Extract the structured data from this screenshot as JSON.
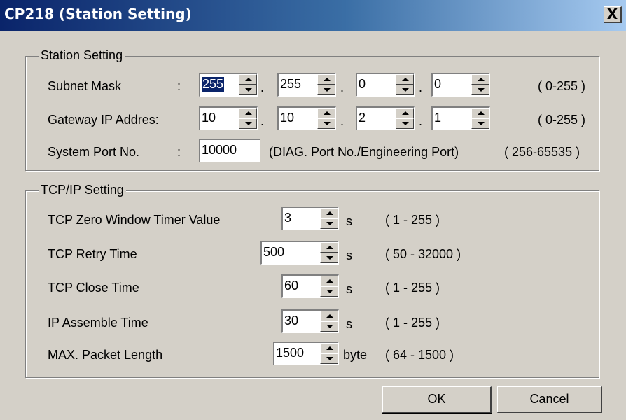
{
  "window": {
    "title": "CP218 (Station Setting)",
    "close_label": "X"
  },
  "station": {
    "legend": "Station Setting",
    "subnet_mask": {
      "label": "Subnet Mask",
      "colon": ":",
      "octets": [
        "255",
        "255",
        "0",
        "0"
      ],
      "range": "( 0-255 )"
    },
    "gateway": {
      "label": "Gateway IP Addres:",
      "octets": [
        "10",
        "10",
        "2",
        "1"
      ],
      "range": "( 0-255 )"
    },
    "system_port": {
      "label": "System Port No.",
      "colon": ":",
      "value": "10000",
      "note": "(DIAG. Port No./Engineering Port)",
      "range": "( 256-65535 )"
    },
    "dot": "."
  },
  "tcpip": {
    "legend": "TCP/IP Setting",
    "rows": [
      {
        "label": "TCP Zero Window Timer Value",
        "value": "3",
        "unit": "s",
        "range": "( 1 - 255 )"
      },
      {
        "label": "TCP Retry Time",
        "value": "500",
        "unit": "s",
        "range": "( 50 - 32000 )"
      },
      {
        "label": "TCP Close Time",
        "value": "60",
        "unit": "s",
        "range": "( 1 - 255 )"
      },
      {
        "label": "IP  Assemble Time",
        "value": "30",
        "unit": "s",
        "range": "( 1 - 255 )"
      },
      {
        "label": "MAX. Packet Length",
        "value": "1500",
        "unit": "byte",
        "range": "( 64 - 1500 )"
      }
    ]
  },
  "buttons": {
    "ok": "OK",
    "cancel": "Cancel"
  }
}
